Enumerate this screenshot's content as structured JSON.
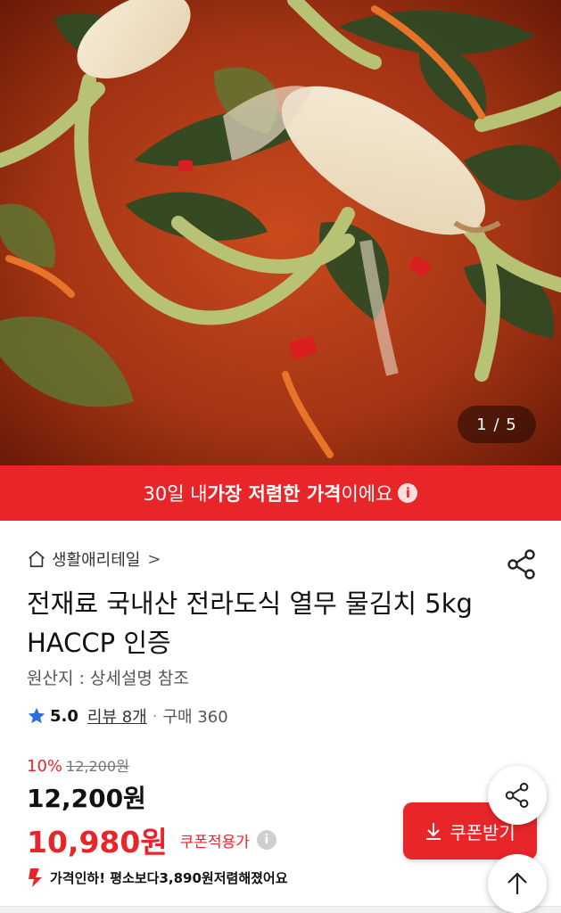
{
  "gallery": {
    "counter": "1 / 5",
    "image_subject": "yeolmu-mul-kimchi-photo"
  },
  "promo": {
    "prefix": "30일 내 ",
    "highlight": "가장 저렴한 가격",
    "suffix": "이에요",
    "info_icon": "i"
  },
  "store": {
    "name": "생활애리테일",
    "chevron": ">"
  },
  "product": {
    "title": "전재료 국내산 전라도식 열무 물김치 5kg HACCP 인증",
    "origin": "원산지 : 상세설명 참조"
  },
  "rating": {
    "score": "5.0",
    "review_label": "리뷰 8개",
    "separator": "·",
    "sales": "구매 360"
  },
  "price": {
    "discount_rate": "10%",
    "original_struck": "12,200원",
    "list_price": "12,200원",
    "sale_price": "10,980원",
    "sale_tag": "쿠폰적용가",
    "info_icon": "i"
  },
  "price_drop": {
    "prefix": "가격인하! 평소보다 ",
    "amount": "3,890원",
    "suffix": " 저렴해졌어요"
  },
  "coupon_button": {
    "label": "쿠폰받기"
  },
  "colors": {
    "brand_red": "#e8262a",
    "star_blue": "#2a6fdb",
    "text_dark": "#111111",
    "text_gray": "#555555"
  },
  "icons": {
    "home": "home-icon",
    "share": "share-icon",
    "star": "star-icon",
    "down_arrow": "arrow-down-icon",
    "download": "download-icon",
    "up_arrow": "arrow-up-icon"
  }
}
